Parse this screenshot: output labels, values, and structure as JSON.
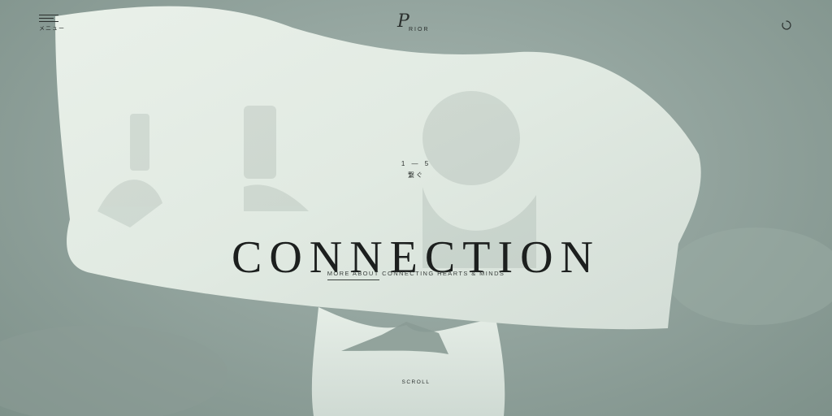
{
  "header": {
    "menu_label": "メニュー",
    "logo_script": "P",
    "logo_text": "RIOR"
  },
  "hero": {
    "chapter_number": "1 — 5",
    "chapter_japanese": "繋ぐ",
    "headline": "CONNECTION",
    "more_link_highlight": "MORE ABOUT",
    "more_link_rest": " CONNECTING HEARTS & MINDS",
    "scroll_label": "SCROLL"
  },
  "colors": {
    "background": "#8fa09a",
    "fabric": "#e4ece5",
    "text": "#1c1f1e"
  },
  "icons": {
    "menu": "hamburger-icon",
    "loader": "loader-ring-icon"
  }
}
